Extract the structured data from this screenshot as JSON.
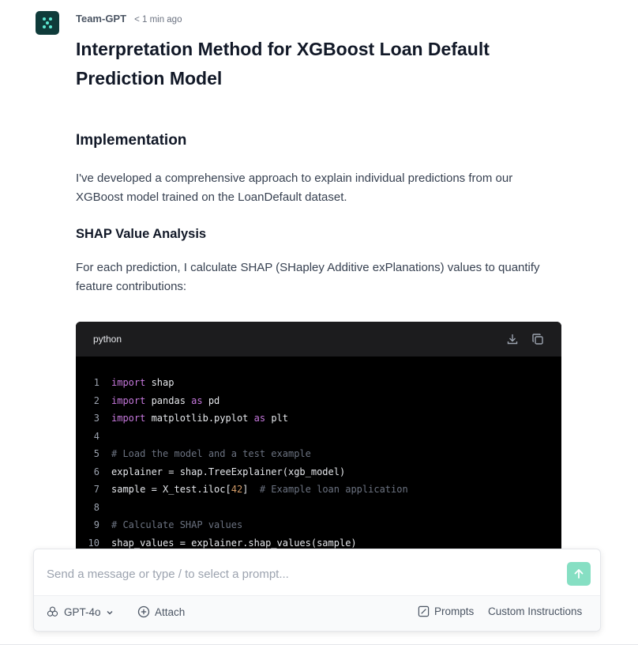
{
  "message": {
    "author": "Team-GPT",
    "time": "< 1 min ago",
    "title": "Interpretation Method for XGBoost Loan Default Prediction Model",
    "section_heading": "Implementation",
    "intro_paragraph": "I've developed a comprehensive approach to explain individual predictions from our XGBoost model trained on the LoanDefault dataset.",
    "subsection_heading": "SHAP Value Analysis",
    "shap_paragraph": "For each prediction, I calculate SHAP (SHapley Additive exPlanations) values to quantify feature contributions:"
  },
  "code_block": {
    "language": "python",
    "download_icon": "download-icon",
    "copy_icon": "copy-icon",
    "lines": [
      {
        "n": "1",
        "text": "import shap"
      },
      {
        "n": "2",
        "text": "import pandas as pd"
      },
      {
        "n": "3",
        "text": "import matplotlib.pyplot as plt"
      },
      {
        "n": "4",
        "text": ""
      },
      {
        "n": "5",
        "text": "# Load the model and a test example"
      },
      {
        "n": "6",
        "text": "explainer = shap.TreeExplainer(xgb_model)"
      },
      {
        "n": "7",
        "text": "sample = X_test.iloc[42]  # Example loan application"
      },
      {
        "n": "8",
        "text": ""
      },
      {
        "n": "9",
        "text": "# Calculate SHAP values"
      },
      {
        "n": "10",
        "text": "shap_values = explainer.shap_values(sample)"
      }
    ]
  },
  "composer": {
    "placeholder": "Send a message or type / to select a prompt...",
    "model_label": "GPT-4o",
    "attach_label": "Attach",
    "prompts_label": "Prompts",
    "custom_instructions_label": "Custom Instructions"
  },
  "colors": {
    "avatar_bg": "#0f3b3a",
    "send_button": "#86dfc3",
    "code_bg": "#000000",
    "keyword": "#c678dd",
    "comment": "#6b7280"
  }
}
